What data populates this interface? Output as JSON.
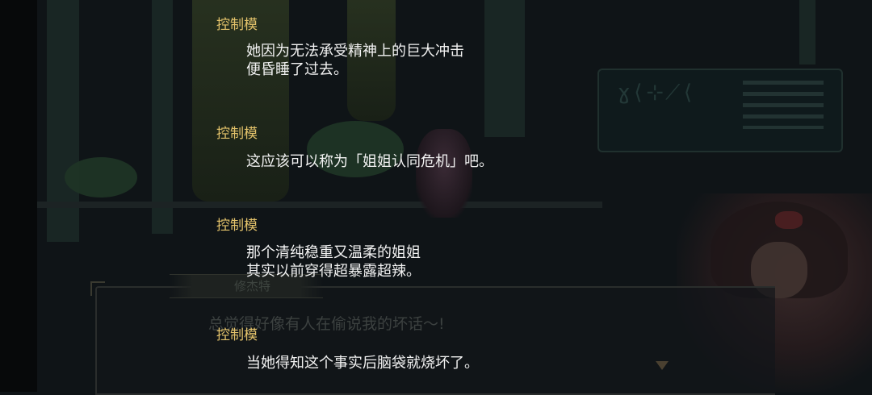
{
  "background": {
    "panel_glyphs": "ɣ⟨⊹⟋⟨",
    "underlay_speaker": "修杰特",
    "underlay_line": "总觉得好像有人在偷说我的坏话～!"
  },
  "log": [
    {
      "speaker": "控制模",
      "lines": [
        "她因为无法承受精神上的巨大冲击",
        "便昏睡了过去。"
      ]
    },
    {
      "speaker": "控制模",
      "lines": [
        "这应该可以称为「姐姐认同危机」吧。"
      ]
    },
    {
      "speaker": "控制模",
      "lines": [
        "那个清纯稳重又温柔的姐姐",
        "其实以前穿得超暴露超辣。"
      ]
    },
    {
      "speaker": "控制模",
      "lines": [
        "当她得知这个事实后脑袋就烧坏了。"
      ]
    }
  ],
  "colors": {
    "speaker": "#e4c36b",
    "dialogue": "#f2f2f2",
    "backdrop": "#0f1417"
  }
}
